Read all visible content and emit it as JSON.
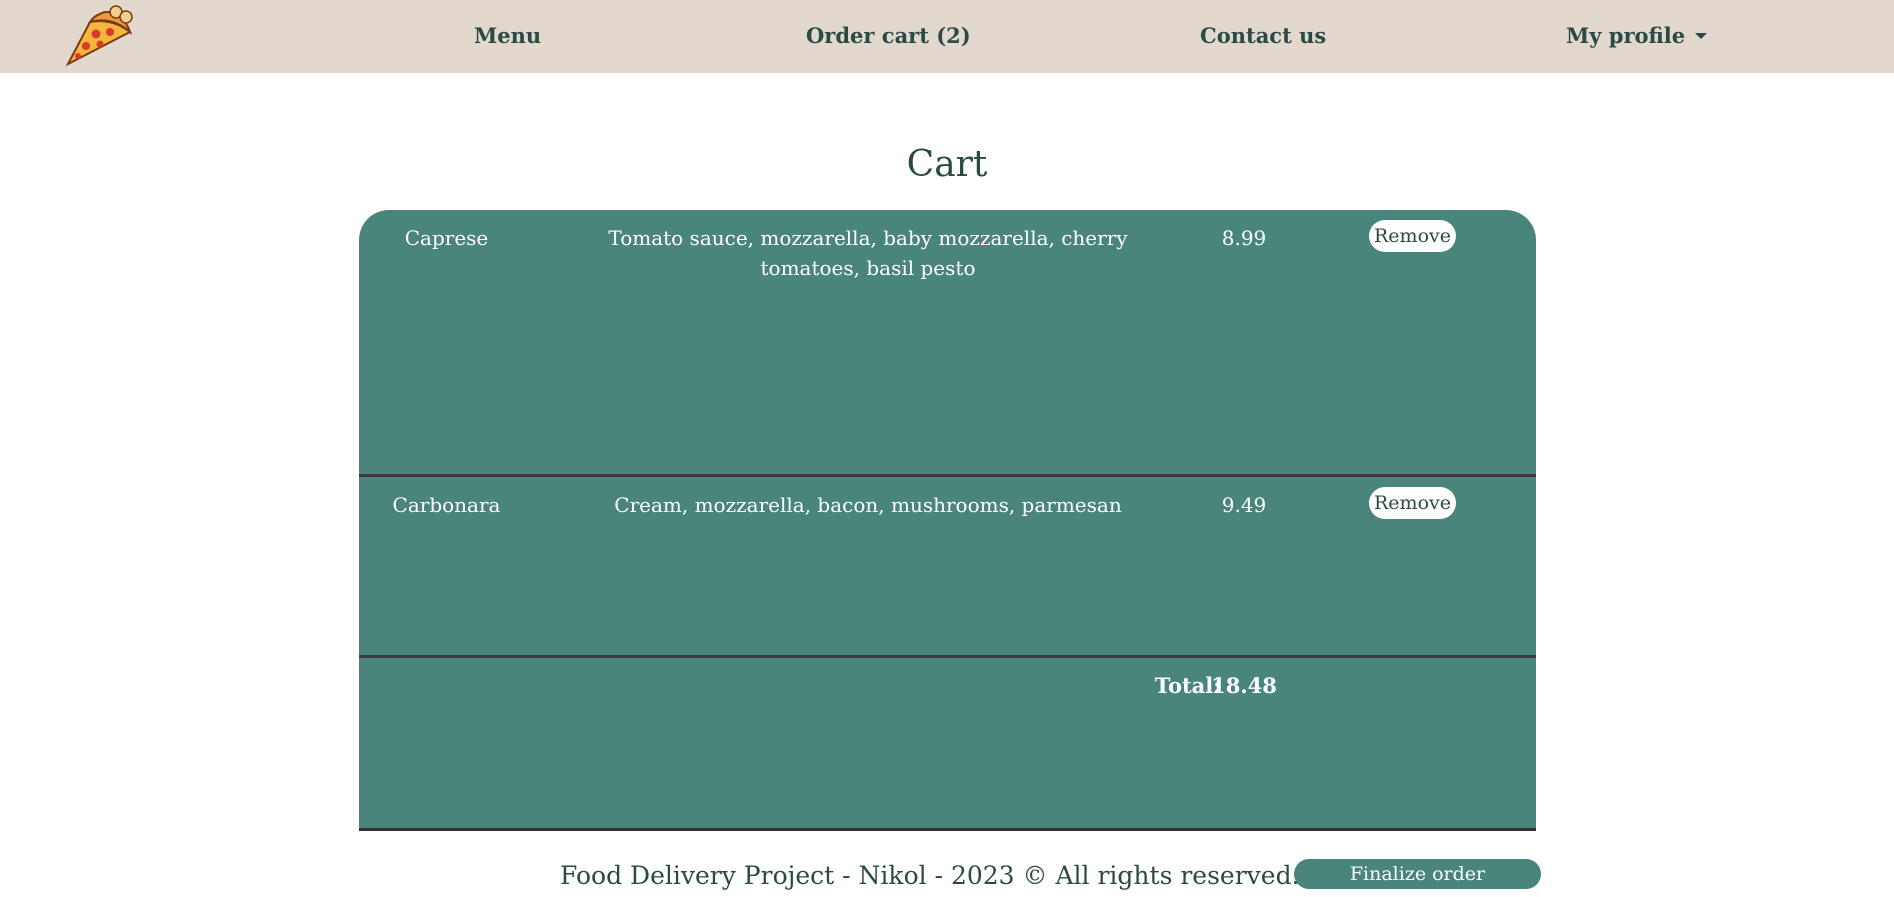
{
  "nav": {
    "logo_icon": "pizza-slice-icon",
    "menu": "Menu",
    "cart": "Order cart (2)",
    "contact": "Contact us",
    "profile": "My profile"
  },
  "page": {
    "title": "Cart"
  },
  "cart": {
    "items": [
      {
        "name": "Caprese",
        "description": "Tomato sauce, mozzarella, baby mozzarella, cherry tomatoes, basil pesto",
        "price": "8.99",
        "remove_label": "Remove"
      },
      {
        "name": "Carbonara",
        "description": "Cream, mozzarella, bacon, mushrooms, parmesan",
        "price": "9.49",
        "remove_label": "Remove"
      }
    ],
    "total_label": "Total:",
    "total_value": "18.48"
  },
  "footer": {
    "text": "Food Delivery Project - Nikol - 2023 © All rights reserved.",
    "finalize_label": "Finalize order"
  },
  "colors": {
    "header_bg": "#e3d8cd",
    "panel_bg": "#4a857c",
    "text_dark": "#2c4a44"
  }
}
